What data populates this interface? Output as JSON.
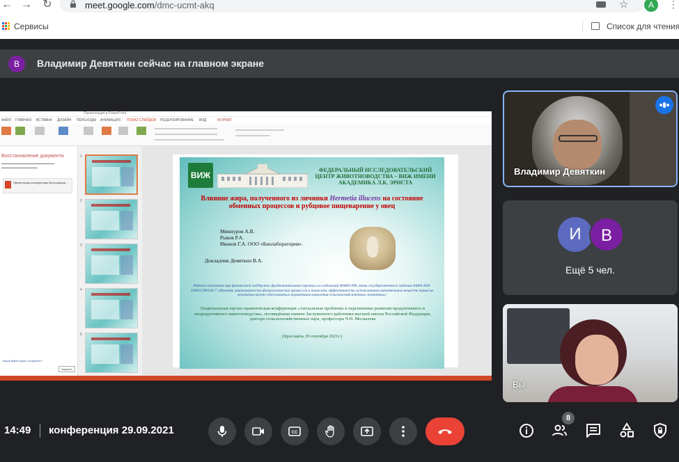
{
  "browser": {
    "url_host": "meet.google.com",
    "url_path": "/dmc-ucmt-akq",
    "profile_initial": "A",
    "bookmarks": {
      "apps_label": "Сервисы",
      "reading_list_label": "Список для чтения"
    }
  },
  "banner": {
    "avatar_initial": "В",
    "text": "Владимир Девяткин сейчас на главном экране"
  },
  "presentation": {
    "window_title": "Презентация в PowerPoint",
    "ribbon_tabs": [
      "ФАЙЛ",
      "ГЛАВНАЯ",
      "ВСТАВКА",
      "ДИЗАЙН",
      "ПЕРЕХОДЫ",
      "АНИМАЦИЯ",
      "ПОКАЗ СЛАЙДОВ",
      "РЕЦЕНЗИРОВАНИЕ",
      "ВИД",
      "ФОРМАТ"
    ],
    "left_pane": {
      "title": "Восстановление документа",
      "file_label": "Презентация конференция Вологодская...",
      "link": "Какой файл нужно сохранить?",
      "close_button": "Закрыть"
    },
    "slide_count": 5,
    "slide": {
      "logo": "ВИЖ",
      "institute": "ФЕДЕРАЛЬНЫЙ ИССЛЕДОВАТЕЛЬСКИЙ ЦЕНТР ЖИВОТНОВОДСТВА – ВИЖ ИМЕНИ АКАДЕМИКА Л.К. ЭРНСТА",
      "title_part1": "Влияние жира, полученного из личинки ",
      "title_species": "Hermetia illucens",
      "title_part2": " на состояние обменных процессов и рубцовое пищеварение у овец",
      "authors": [
        "Миннуров А.В.",
        "Рыков Р.А.",
        "Иванов Г.А. ООО «Биолаборатория»."
      ],
      "speaker": "Докладчик Девяткин В.А.",
      "funding": "Работа выполнена при финансовой поддержке фундаментальных научных исследований ФАНО РФ, тема государственного задания АААА-А18-118021590136-7 «Изучить закономерности физиологических процессов и повысить эффективность использования питательных веществ корма на основании научно обоснованных нормативов кормления сельскохозяйственных животных»",
      "conference": "Национальная научно-практическая конференция «Актуальные проблемы и перспективы развития продуктивного и непродуктивного животноводства», посвящённая памяти Заслуженного работника высшей школы Российской Федерации, доктора сельскохозяйственных наук, профессора Ч.Н. Москалева",
      "city_date": "(Ярославль 29 сентября 2021г.)"
    }
  },
  "participants": {
    "speaker_name": "Владимир Девяткин",
    "others_avatars": [
      "И",
      "В"
    ],
    "others_label": "Ещё 5 чел.",
    "self_label": "Вы"
  },
  "bottom_bar": {
    "time": "14:49",
    "meeting_name": "конференция 29.09.2021",
    "participants_count": "8"
  },
  "colors": {
    "end_call": "#ea4335",
    "accent": "#8ab4f8",
    "bg": "#202124"
  }
}
